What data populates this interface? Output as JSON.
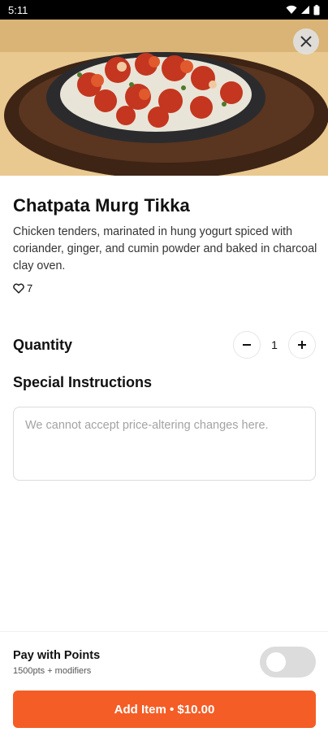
{
  "status_bar": {
    "time": "5:11"
  },
  "item": {
    "name": "Chatpata Murg Tikka",
    "description": "Chicken tenders, marinated in hung yogurt spiced with coriander, ginger, and cumin powder and baked in charcoal clay oven.",
    "likes": "7"
  },
  "quantity": {
    "label": "Quantity",
    "value": "1"
  },
  "instructions": {
    "label": "Special Instructions",
    "placeholder": "We cannot accept price-altering changes here.",
    "value": ""
  },
  "points": {
    "title": "Pay with Points",
    "subtitle": "1500pts + modifiers",
    "enabled": false
  },
  "cta": {
    "label": "Add Item • $10.00"
  },
  "colors": {
    "accent": "#f45d25",
    "toggle_off": "#dcdcdc"
  },
  "icons": [
    "wifi-icon",
    "signal-icon",
    "battery-icon",
    "close-icon",
    "heart-icon",
    "minus-icon",
    "plus-icon"
  ]
}
